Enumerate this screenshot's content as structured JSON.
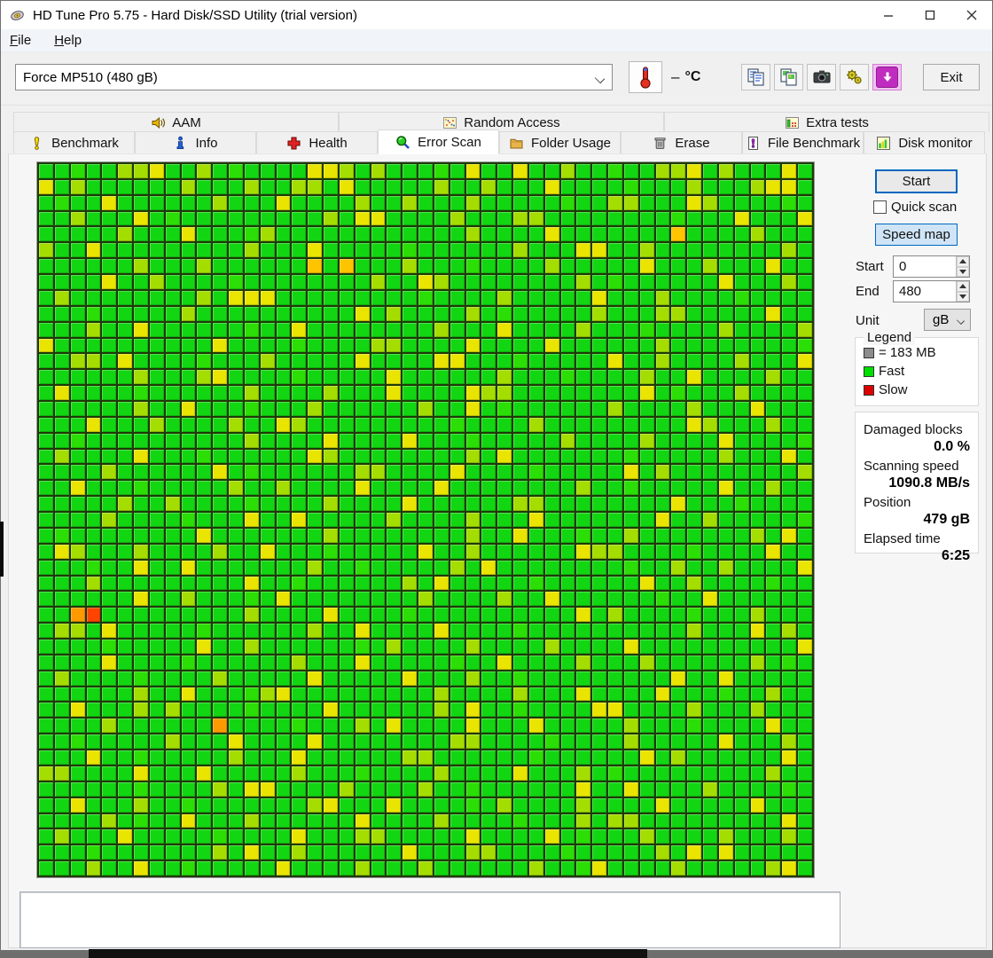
{
  "window": {
    "title": "HD Tune Pro 5.75 - Hard Disk/SSD Utility (trial version)"
  },
  "menu": {
    "items": [
      {
        "label": "File"
      },
      {
        "label": "Help"
      }
    ]
  },
  "toolbar": {
    "drive_select": "Force MP510 (480 gB)",
    "temperature_value": "–",
    "temperature_unit": "°C",
    "buttons": [
      "copy-text-icon",
      "copy-image-icon",
      "camera-icon",
      "options-icon",
      "save-screenshot-icon"
    ],
    "exit_label": "Exit"
  },
  "tabs": {
    "row1": [
      {
        "label": "AAM"
      },
      {
        "label": "Random Access"
      },
      {
        "label": "Extra tests"
      }
    ],
    "row2": [
      {
        "label": "Benchmark"
      },
      {
        "label": "Info"
      },
      {
        "label": "Health"
      },
      {
        "label": "Error Scan",
        "active": true
      },
      {
        "label": "Folder Usage"
      },
      {
        "label": "Erase"
      },
      {
        "label": "File Benchmark"
      },
      {
        "label": "Disk monitor"
      }
    ],
    "active_tab": "Error Scan"
  },
  "error_scan": {
    "start_button": "Start",
    "quick_scan_label": "Quick scan",
    "quick_scan_checked": false,
    "speed_map_button": "Speed map",
    "start_field": {
      "label": "Start",
      "value": "0"
    },
    "end_field": {
      "label": "End",
      "value": "480"
    },
    "unit_field": {
      "label": "Unit",
      "value": "gB"
    },
    "legend": {
      "title": "Legend",
      "block_label": "= 183 MB",
      "fast_label": "Fast",
      "slow_label": "Slow",
      "block_color": "#8c8c8c",
      "fast_color": "#00e000",
      "slow_color": "#dd0000"
    },
    "stats": [
      {
        "label": "Damaged blocks",
        "value": "0.0 %"
      },
      {
        "label": "Scanning speed",
        "value": "1090.8 MB/s"
      },
      {
        "label": "Position",
        "value": "479 gB"
      },
      {
        "label": "Elapsed time",
        "value": "6:25"
      }
    ]
  },
  "speed_map": {
    "cols": 49,
    "rows": 45,
    "palette": {
      ".": "#12d612",
      "g": "#2ade06",
      "l": "#a4dd00",
      "y": "#e9e400",
      "a": "#ffc400",
      "o": "#ff9900",
      "r": "#ff4400"
    },
    "cells": [
      "..g..lly..l.g....yyl.l...g.y..y..l..g..lly.l...y.",
      "y.l......l...l..ll.y.....l..l...y....g...l...lyy.",
      ".g..y......l...y....l..l...l.....g..ll...yl....g.",
      "..l...y.g.........l.yy....l...ll........g...y...y",
      ".....l...y...gl............l....y.......a....l...",
      "l..y.........l...y.....g......l...yy..l........l.",
      "......l...l......a.a...l...g....l.....y...l...y..",
      "....y..l....g........l..yl........l.g......y...l.",
      ".l........l.yyy.........g....l.....y...l....g....",
      "...g.....l..........y.l....l.g.....l...ll.....y..",
      "...l..y......g..y........l...y....l...g....l....l",
      "y..........y....g....ll....y....y......l........g",
      "..ll.y....g...l.....y....yy...g.....y..l....l...y",
      "......l...ly....g.....y......l...g....l..y....l..",
      ".y....g......l....l...y....yll........y.g...l....",
      "......l..y...g...l......l..y.g......l....l...y...",
      "...y...l....l..yl.........g....l.........yl...l..",
      "..g..........l....y....y...g.....l....l....y....g",
      ".l....y...g......yl........l.y.......g.....l...y.",
      "....l......y.g......ll....y....g.....y.l........l",
      "..y...g.....l..l....y....y........l..g.....y..l..",
      ".....l..l....g....l....y......ll........y...g....",
      "....l....g...y..y.....l....l...y.......y..l.....g",
      ".g........y.......l........l..y...g..l.......l.y.",
      ".yl...l....l..y...g.....y..l......yll....g....y..",
      "...g..y..y.......l..g.....l.y........g..l..l....y",
      "...l.........y..g......l.y.....g......y..l....g..",
      "......y..l...g.y........l....l..y......g..y......",
      "..or.........l....y....g..........y.l....g...l...",
      ".ll.y.....g......l..y....y....g..........l...y.l.",
      "....g.....y..l......g.l....l....l....y..........y",
      "....y....g......l...y.....g..y....l...l......l.g.",
      ".l....g....l.....y.....y...l..g.........y..y.....",
      "......l..y...gly.........l....l...y....y...g..l..",
      "..y...l.l....g....y......l.y..g....yy....l...l...",
      "....l......o....g...l.y....y...y.....l...g....y..",
      "..g.....l...y....y........ll....g....l.....y...l.",
      "...y..g.....l...y......ll......g......y.l......y.",
      "ll....y...y.....l...g....l....y...l.g.........l..",
      "......g....l.yy....l....l..g......y..y....l....g.",
      "..y...l..g.......ly...y....g.l....l....y.....y...",
      "....l.g..y...l......y....l....g...l.ll.........y.",
      ".l...y.....g....y...ll.....y....y.g...l....l...l.",
      "...g.......l.y..l......y...ll....g.....l.y.y.....",
      "...l..y..g.....y....l...l......l..gy....l.....ly."
    ]
  }
}
